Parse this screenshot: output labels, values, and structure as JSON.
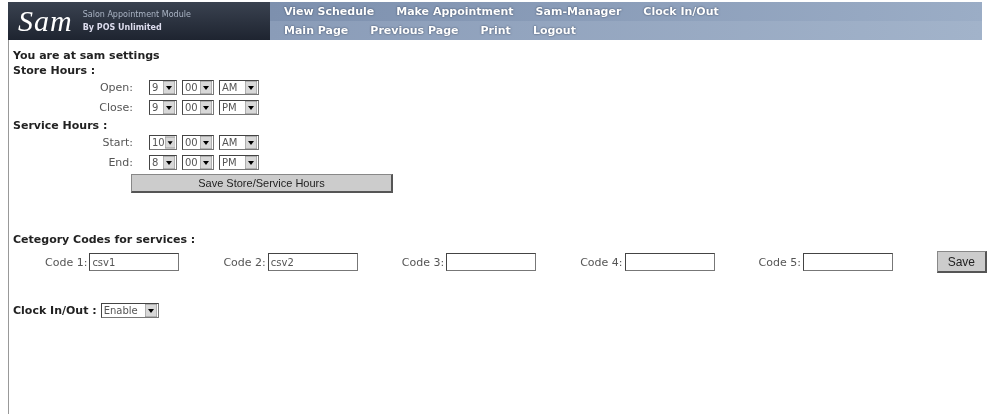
{
  "header": {
    "logo": "Sam",
    "subtitle": "Salon Appointment Module",
    "byline": "By POS Unlimited"
  },
  "nav_rows": [
    [
      "View Schedule",
      "Make Appointment",
      "Sam-Manager",
      "Clock In/Out"
    ],
    [
      "Main Page",
      "Previous Page",
      "Print",
      "Logout"
    ]
  ],
  "breadcrumb": "You are at sam settings",
  "sections": [
    {
      "title": "Store Hours :",
      "rows": [
        {
          "label": "Open:",
          "hour": "9",
          "minute": "00",
          "period": "AM"
        },
        {
          "label": "Close:",
          "hour": "9",
          "minute": "00",
          "period": "PM"
        }
      ]
    },
    {
      "title": "Service Hours :",
      "rows": [
        {
          "label": "Start:",
          "hour": "10",
          "minute": "00",
          "period": "AM"
        },
        {
          "label": "End:",
          "hour": "8",
          "minute": "00",
          "period": "PM"
        }
      ]
    }
  ],
  "save_hours_button": "Save Store/Service Hours",
  "category_codes": {
    "title": "Cetegory Codes for services :",
    "codes": [
      {
        "label": "Code 1:",
        "value": "csv1"
      },
      {
        "label": "Code 2:",
        "value": "csv2"
      },
      {
        "label": "Code 3:"
      },
      {
        "label": "Code 4:"
      },
      {
        "label": "Code 5:"
      }
    ],
    "save_button": "Save"
  },
  "clock": {
    "label": "Clock In/Out :",
    "value": "Enable"
  }
}
